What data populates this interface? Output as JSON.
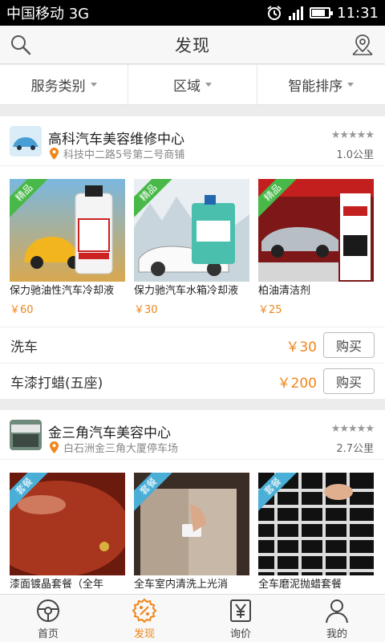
{
  "status": {
    "carrier": "中国移动 3G",
    "time": "11:31"
  },
  "header": {
    "title": "发现"
  },
  "filters": [
    "服务类别",
    "区域",
    "智能排序"
  ],
  "shops": [
    {
      "name": "高科汽车美容维修中心",
      "address": "科技中二路5号第二号商铺",
      "distance": "1.0公里",
      "rating": 5,
      "products": [
        {
          "tag": "精品",
          "name": "保力驰油性汽车冷却液",
          "price": "￥60"
        },
        {
          "tag": "精品",
          "name": "保力驰汽车水箱冷却液",
          "price": "￥30"
        },
        {
          "tag": "精品",
          "name": "柏油清洁剂",
          "price": "￥25"
        }
      ],
      "services": [
        {
          "name": "洗车",
          "price": "￥30",
          "buy": "购买"
        },
        {
          "name": "车漆打蜡(五座)",
          "price": "￥200",
          "buy": "购买"
        }
      ]
    },
    {
      "name": "金三角汽车美容中心",
      "address": "白石洲金三角大厦停车场",
      "distance": "2.7公里",
      "rating": 5,
      "products": [
        {
          "tag": "套餐",
          "name": "漆面镀晶套餐（全年",
          "price": ""
        },
        {
          "tag": "套餐",
          "name": "全车室内清洗上光消",
          "price": ""
        },
        {
          "tag": "套餐",
          "name": "全车磨泥抛蜡套餐",
          "price": ""
        }
      ]
    }
  ],
  "tabs": [
    {
      "label": "首页",
      "icon": "steering-wheel-icon"
    },
    {
      "label": "发现",
      "icon": "discount-icon",
      "active": true
    },
    {
      "label": "询价",
      "icon": "yen-icon"
    },
    {
      "label": "我的",
      "icon": "person-icon"
    }
  ],
  "colors": {
    "accent": "#f08519",
    "tag_green": "#48b848",
    "tag_blue": "#4aaed6"
  }
}
